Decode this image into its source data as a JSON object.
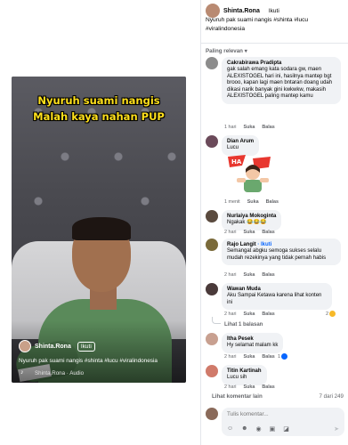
{
  "video": {
    "caption_line_1": "Nyuruh suami nangis",
    "caption_line_2": "Malah kaya nahan PUP",
    "author": "Shinta.Rona",
    "follow_label": "Ikuti",
    "description": "Nyuruh pak suami nangis #shinta #lucu #viralindonesia",
    "audio": "Shinta.Rona · Audio"
  },
  "post": {
    "author": "Shinta.Rona",
    "follow_label": "Ikuti",
    "caption": "Nyuruh pak suami nangis #shinta #lucu #viralindonesia"
  },
  "sort_label": "Paling relevan",
  "comments": [
    {
      "name": "Cakrabirawa Pradipta",
      "text": "gak salah emang kata sodara gw, maen ALEXISTOGEL hari ini, hasilnya mantep bgt brooo, kapan lagi maen bntaran doang udah dikasi narik banyak gini kwkwkw, makasih ALEXISTOGEL paling mantep kamu",
      "time": "1 hari",
      "like": "Suka",
      "reply": "Balas"
    },
    {
      "name": "Dian Arum",
      "text": "Lucu",
      "time": "1 menit",
      "like": "Suka",
      "reply": "Balas",
      "sticker_text": "HA HA"
    },
    {
      "name": "Nurlaiya Mokoginta",
      "text": "Ngakak 😂😂😂",
      "time": "2 hari",
      "like": "Suka",
      "reply": "Balas"
    },
    {
      "name": "Rajo Langit",
      "badge": "· Ikuti",
      "text": "Semangat abgku semoga sukses selalu mudah rezekinya yang tidak pernah habis",
      "time": "2 hari",
      "like": "Suka",
      "reply": "Balas"
    },
    {
      "name": "Wawan Muda",
      "text": "Aku Sampai Ketawa karena lihat konten ini",
      "time": "2 hari",
      "like": "Suka",
      "reply": "Balas",
      "reaction_count": "2"
    },
    {
      "name": "Itha Pesek",
      "text": "Hy selamat malam kk",
      "time": "2 hari",
      "like": "Suka",
      "reply": "Balas",
      "reaction_count": "1"
    },
    {
      "name": "Titin Kartinah",
      "text": "Lucu sih",
      "time": "2 hari",
      "like": "Suka",
      "reply": "Balas"
    }
  ],
  "view_replies": "Lihat 1 balasan",
  "more_comments": "Lihat komentar lain",
  "comment_count": "7 dari 249",
  "compose_placeholder": "Tulis komentar...",
  "colors": {
    "accent": "#0866ff",
    "video_caption": "#ffe01b",
    "bubble": "#f0f2f5"
  }
}
